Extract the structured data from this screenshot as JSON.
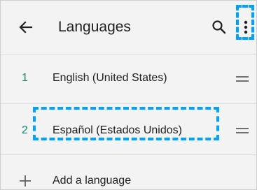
{
  "toolbar": {
    "title": "Languages",
    "back_icon": "arrow-back-icon",
    "search_icon": "search-icon",
    "menu_icon": "more-vert-icon"
  },
  "languages": [
    {
      "number": "1",
      "label": "English (United States)",
      "handle_icon": "drag-handle-icon"
    },
    {
      "number": "2",
      "label": "Español (Estados Unidos)",
      "handle_icon": "drag-handle-icon"
    }
  ],
  "add_language": {
    "label": "Add a language",
    "icon": "plus-icon"
  },
  "colors": {
    "background": "#f3f3f3",
    "accent_number": "#0f8a74",
    "highlight_dashes": "#00a2ff",
    "text": "#202124"
  }
}
